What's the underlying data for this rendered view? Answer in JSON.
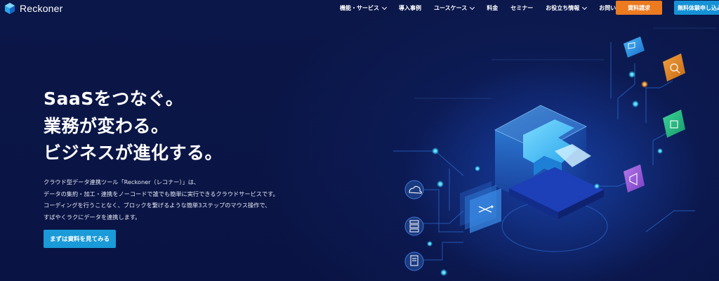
{
  "brand": {
    "name": "Reckoner"
  },
  "nav": {
    "items": [
      {
        "label": "機能・サービス",
        "dropdown": true
      },
      {
        "label": "導入事例",
        "dropdown": false
      },
      {
        "label": "ユースケース",
        "dropdown": true
      },
      {
        "label": "料金",
        "dropdown": false
      },
      {
        "label": "セミナー",
        "dropdown": false
      },
      {
        "label": "お役立ち情報",
        "dropdown": true
      },
      {
        "label": "お問い合わせ",
        "dropdown": false
      }
    ],
    "doc_request": "資料請求",
    "free_trial": "無料体験申し込み"
  },
  "hero": {
    "headline": [
      "SaaSをつなぐ。",
      "業務が変わる。",
      "ビジネスが進化する。"
    ],
    "description": [
      "クラウド型データ連携ツール「Reckoner（レコナー）」は、",
      "データの集約・加工・連携をノーコードで誰でも簡単に実行できるクラウドサービスです。",
      "コーディングを行うことなく、ブロックを繋げるような簡単3ステップのマウス操作で、",
      "すばやくラクにデータを連携します。"
    ],
    "cta": "まずは資料を見てみる"
  },
  "colors": {
    "background": "#0a1545",
    "doc_button": "#ec7a1f",
    "trial_button": "#1592d6",
    "cta_button": "#1a9ad8",
    "accent_cyan": "#3fd4ff"
  },
  "icons": [
    "cloud-icon",
    "server-icon",
    "document-icon",
    "shuffle-icon",
    "chat-icon",
    "search-doc-icon",
    "chip-icon",
    "megaphone-icon"
  ]
}
